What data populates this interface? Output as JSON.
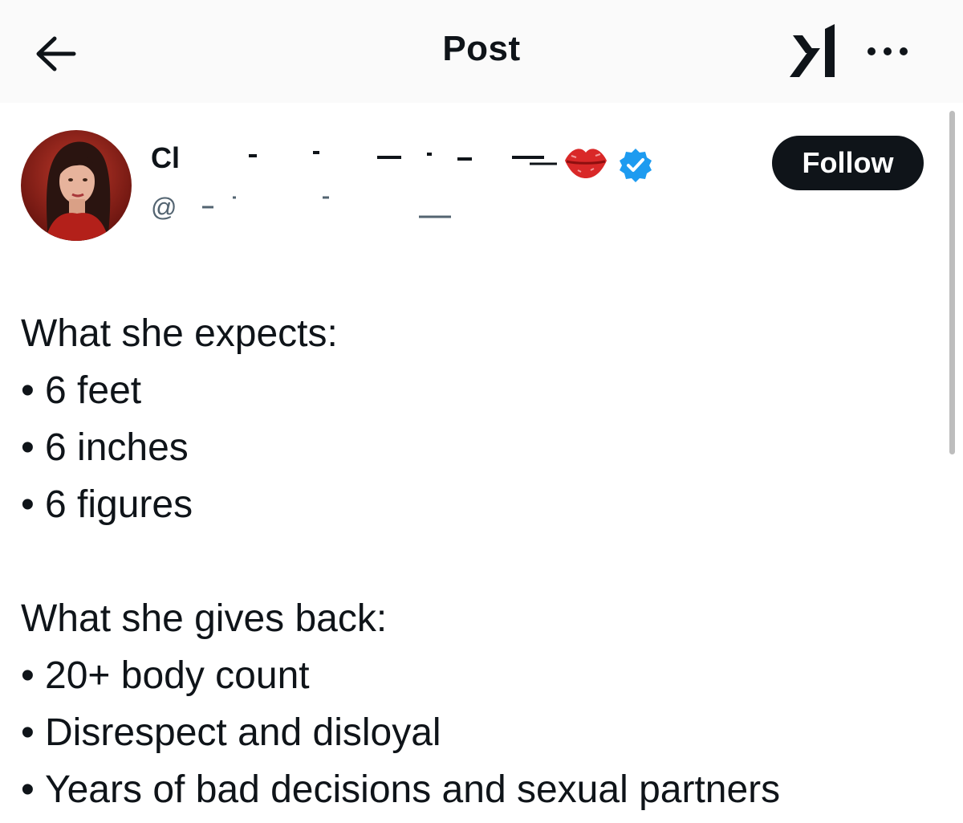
{
  "header": {
    "title": "Post",
    "back_icon": "arrow-left-icon",
    "logo_icon": "xai-logo-icon",
    "more_icon": "more-dots-icon"
  },
  "author": {
    "display_name": "Cl",
    "handle": "@",
    "emoji_icon": "lips-icon",
    "verified_icon": "verified-badge-icon",
    "verified_color": "#1d9bf0"
  },
  "follow_button": {
    "label": "Follow",
    "background": "#0f1419"
  },
  "post": {
    "expects_heading": "What she expects:",
    "expects_items": [
      "6 feet",
      "6 inches",
      "6 figures"
    ],
    "gives_heading": "What she gives back:",
    "gives_items": [
      "20+ body count",
      "Disrespect and disloyal",
      "Years of bad decisions and sexual partners"
    ],
    "bullet": "•"
  }
}
